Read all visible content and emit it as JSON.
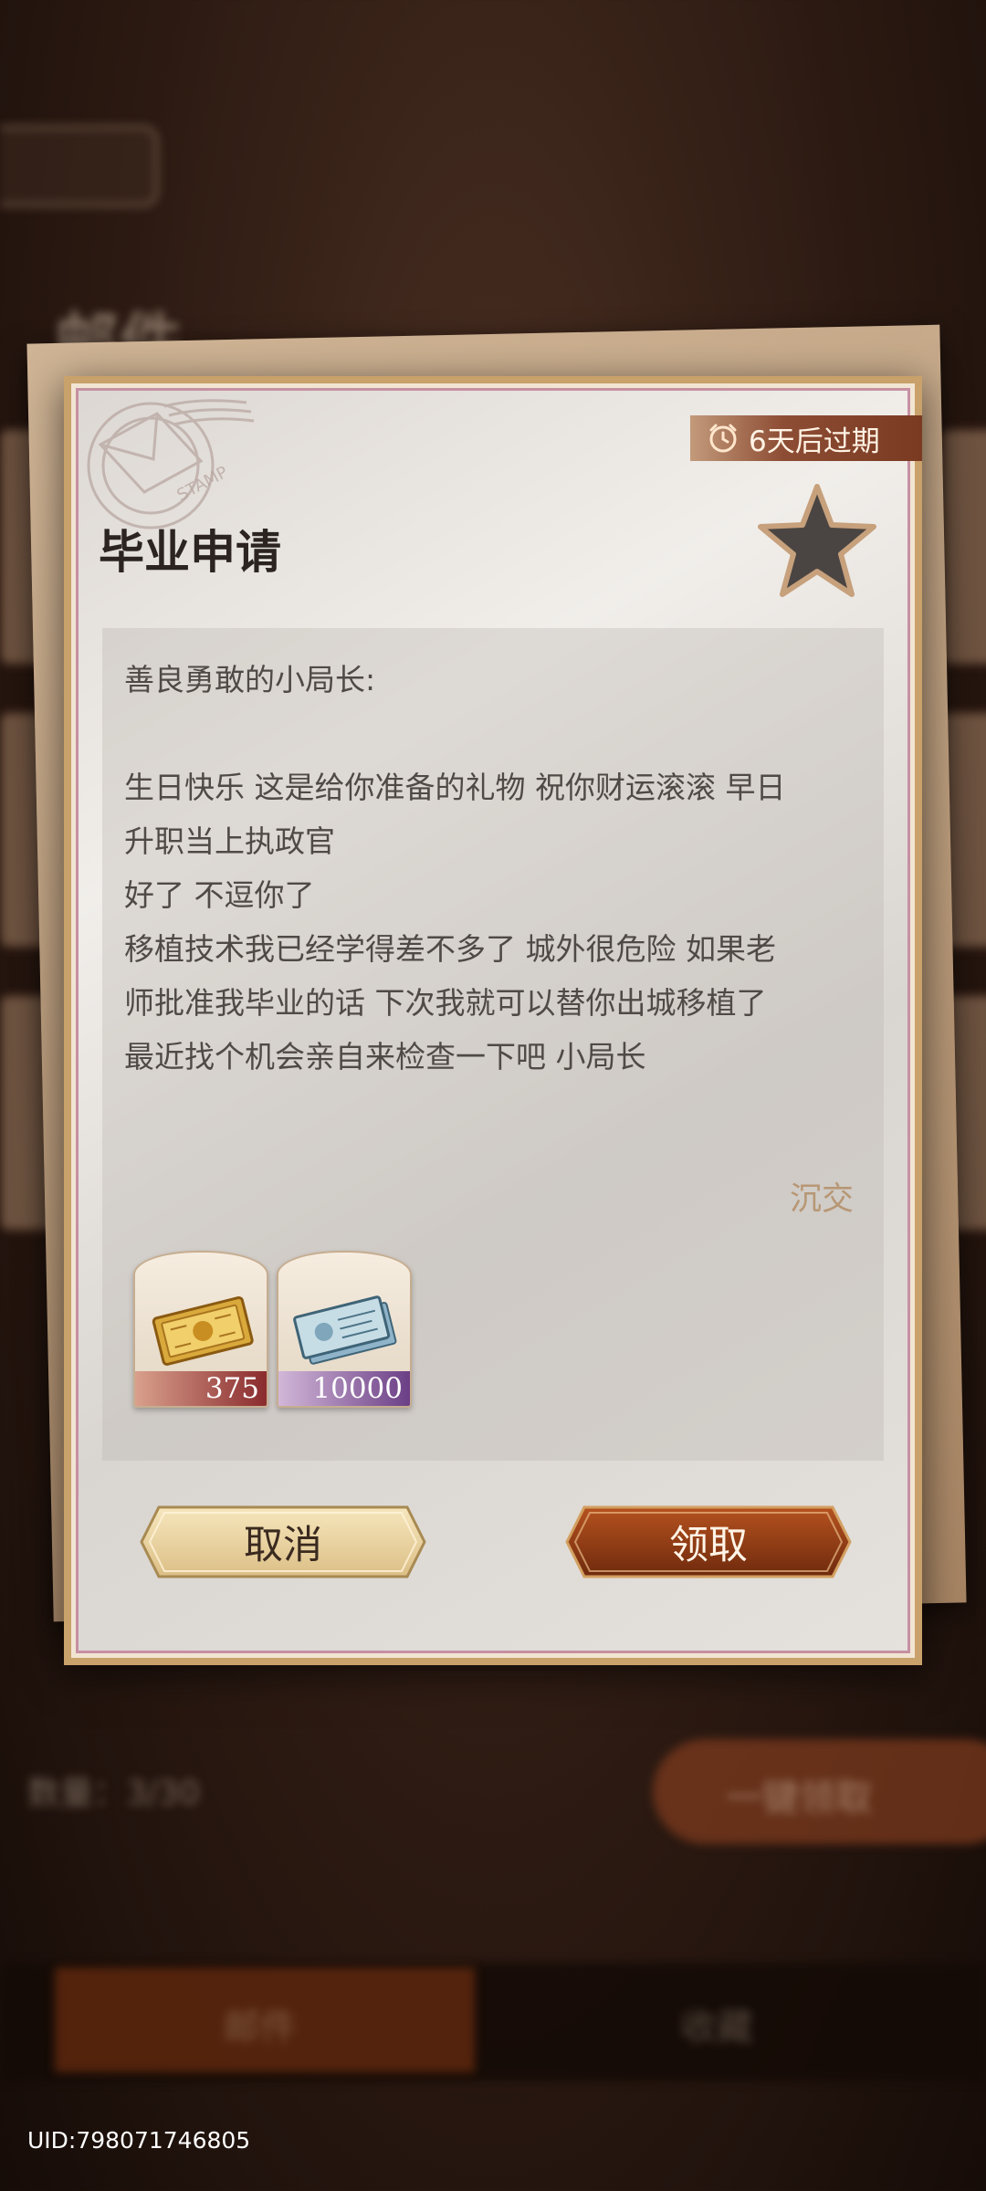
{
  "background": {
    "count_label": "数量：3/30",
    "one_key_label": "一键领取",
    "tabs": [
      "邮件",
      "收藏"
    ]
  },
  "mail": {
    "expire_text": "6天后过期",
    "title": "毕业申请",
    "greeting": "善良勇敢的小局长:",
    "body_lines": [
      "生日快乐 这是给你准备的礼物 祝你财运滚滚 早日",
      "升职当上执政官",
      "好了 不逗你了",
      "移植技术我已经学得差不多了 城外很危险 如果老",
      "师批准我毕业的话 下次我就可以替你出城移植了",
      "最近找个机会亲自来检查一下吧 小局长"
    ],
    "signature": "沉交",
    "rewards": [
      {
        "icon": "gold-ticket-icon",
        "amount": "375"
      },
      {
        "icon": "banknote-icon",
        "amount": "10000"
      }
    ],
    "cancel_label": "取消",
    "claim_label": "领取",
    "stamp_text": "STAMP"
  },
  "uid": "UID:798071746805",
  "colors": {
    "badge": "#7a3a22",
    "claim_button": "#8f3a14",
    "cancel_button": "#e9d3a3",
    "letter_border": "#c9a16a",
    "signature": "#b79775"
  }
}
